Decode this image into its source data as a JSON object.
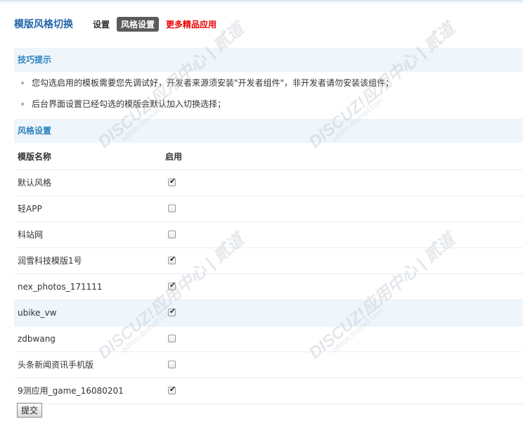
{
  "header": {
    "title": "模版风格切换",
    "nav": {
      "settings": "设置",
      "style_settings": "风格设置",
      "more_apps": "更多精品应用"
    }
  },
  "tips": {
    "heading": "技巧提示",
    "items": [
      "您勾选启用的模板需要您先调试好，开发者来源须安装\"开发者组件\"，非开发者请勿安装该组件；",
      "后台界面设置已经勾选的模版会默认加入切换选择；"
    ]
  },
  "style_section": {
    "heading": "风格设置",
    "columns": [
      "模版名称",
      "启用"
    ],
    "rows": [
      {
        "name": "默认风格",
        "enabled": true
      },
      {
        "name": "轻APP",
        "enabled": false
      },
      {
        "name": "科站网",
        "enabled": false
      },
      {
        "name": "润雪科技模版1号",
        "enabled": true
      },
      {
        "name": "nex_photos_171111",
        "enabled": true
      },
      {
        "name": "ubike_vw",
        "enabled": true
      },
      {
        "name": "zdbwang",
        "enabled": false
      },
      {
        "name": "头条新闻资讯手机版",
        "enabled": false
      },
      {
        "name": "9测应用_game_16080201",
        "enabled": true
      }
    ]
  },
  "submit_label": "提交",
  "watermark": {
    "brand": "DISCUZ!应用中心 | 贰道",
    "url": "addon.dismall.com"
  }
}
